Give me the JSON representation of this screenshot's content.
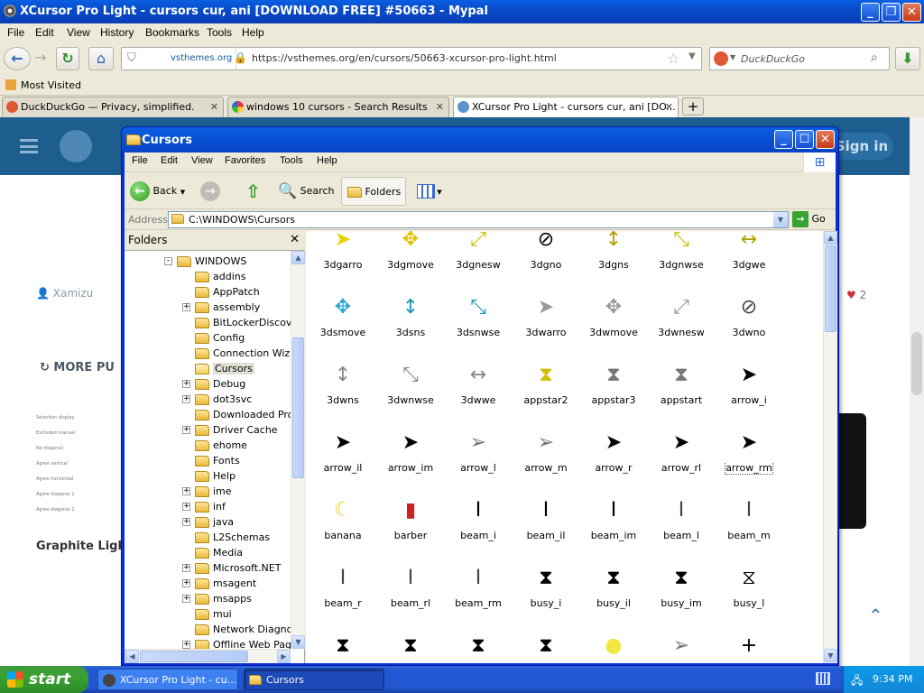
{
  "browser": {
    "title": "XCursor Pro Light - cursors cur, ani [DOWNLOAD FREE] #50663 - Mypal",
    "menu": [
      "File",
      "Edit",
      "View",
      "History",
      "Bookmarks",
      "Tools",
      "Help"
    ],
    "identity": "vsthemes.org",
    "url": "https://vsthemes.org/en/cursors/50663-xcursor-pro-light.html",
    "search_placeholder": "DuckDuckGo",
    "bookmark": "Most Visited",
    "tabs": [
      {
        "label": "DuckDuckGo — Privacy, simplified."
      },
      {
        "label": "windows 10 cursors - Search Results"
      },
      {
        "label": "XCursor Pro Light - cursors cur, ani [DO..."
      }
    ]
  },
  "webpage": {
    "signin": "Sign in",
    "author": "Xamizu",
    "more": "MORE PU",
    "likes": "2",
    "card_title": "Graphite Ligh",
    "card_lines": [
      "Selection display",
      "Excluded manual",
      "No diagonal",
      "Agree vertical",
      "Agree horizontal",
      "Agree diagonal 1",
      "Agree diagonal 2"
    ]
  },
  "explorer": {
    "title": "Cursors",
    "menu": [
      "File",
      "Edit",
      "View",
      "Favorites",
      "Tools",
      "Help"
    ],
    "toolbar": {
      "back": "Back",
      "search": "Search",
      "folders": "Folders"
    },
    "address_label": "Address",
    "address": "C:\\WINDOWS\\Cursors",
    "go": "Go",
    "folders_header": "Folders",
    "tree": [
      {
        "label": "WINDOWS",
        "level": 0,
        "exp": "-"
      },
      {
        "label": "addins",
        "level": 1,
        "exp": ""
      },
      {
        "label": "AppPatch",
        "level": 1,
        "exp": ""
      },
      {
        "label": "assembly",
        "level": 1,
        "exp": "+"
      },
      {
        "label": "BitLockerDiscover",
        "level": 1,
        "exp": ""
      },
      {
        "label": "Config",
        "level": 1,
        "exp": ""
      },
      {
        "label": "Connection Wizar",
        "level": 1,
        "exp": ""
      },
      {
        "label": "Cursors",
        "level": 1,
        "exp": "",
        "selected": true
      },
      {
        "label": "Debug",
        "level": 1,
        "exp": "+"
      },
      {
        "label": "dot3svc",
        "level": 1,
        "exp": "+"
      },
      {
        "label": "Downloaded Prog",
        "level": 1,
        "exp": ""
      },
      {
        "label": "Driver Cache",
        "level": 1,
        "exp": "+"
      },
      {
        "label": "ehome",
        "level": 1,
        "exp": ""
      },
      {
        "label": "Fonts",
        "level": 1,
        "exp": ""
      },
      {
        "label": "Help",
        "level": 1,
        "exp": ""
      },
      {
        "label": "ime",
        "level": 1,
        "exp": "+"
      },
      {
        "label": "inf",
        "level": 1,
        "exp": "+"
      },
      {
        "label": "java",
        "level": 1,
        "exp": "+"
      },
      {
        "label": "L2Schemas",
        "level": 1,
        "exp": ""
      },
      {
        "label": "Media",
        "level": 1,
        "exp": ""
      },
      {
        "label": "Microsoft.NET",
        "level": 1,
        "exp": "+"
      },
      {
        "label": "msagent",
        "level": 1,
        "exp": "+"
      },
      {
        "label": "msapps",
        "level": 1,
        "exp": "+"
      },
      {
        "label": "mui",
        "level": 1,
        "exp": ""
      },
      {
        "label": "Network Diagnost",
        "level": 1,
        "exp": ""
      },
      {
        "label": "Offline Web Page",
        "level": 1,
        "exp": "+"
      }
    ],
    "files": [
      {
        "name": "3dgarro",
        "icon": "arrow-icon",
        "glyph": "➤",
        "color": "#e6d200"
      },
      {
        "name": "3dgmove",
        "icon": "move-icon",
        "glyph": "✥",
        "color": "#e0c000"
      },
      {
        "name": "3dgnesw",
        "icon": "resize-nesw-icon",
        "glyph": "⤢",
        "color": "#c8c000"
      },
      {
        "name": "3dgno",
        "icon": "unavailable-icon",
        "glyph": "⊘",
        "color": "#000000"
      },
      {
        "name": "3dgns",
        "icon": "resize-ns-icon",
        "glyph": "↕",
        "color": "#b0a000"
      },
      {
        "name": "3dgnwse",
        "icon": "resize-nwse-icon",
        "glyph": "⤡",
        "color": "#c8c000"
      },
      {
        "name": "3dgwe",
        "icon": "resize-we-icon",
        "glyph": "↔",
        "color": "#b0a000"
      },
      {
        "name": "3dsmove",
        "icon": "move-icon",
        "glyph": "✥",
        "color": "#2aa6c8"
      },
      {
        "name": "3dsns",
        "icon": "resize-ns-icon",
        "glyph": "↕",
        "color": "#1a96b0"
      },
      {
        "name": "3dsnwse",
        "icon": "resize-nwse-icon",
        "glyph": "⤡",
        "color": "#1a96b0"
      },
      {
        "name": "3dwarro",
        "icon": "arrow-icon",
        "glyph": "➤",
        "color": "#999999"
      },
      {
        "name": "3dwmove",
        "icon": "move-icon",
        "glyph": "✥",
        "color": "#999999"
      },
      {
        "name": "3dwnesw",
        "icon": "resize-nesw-icon",
        "glyph": "⤢",
        "color": "#999999"
      },
      {
        "name": "3dwno",
        "icon": "unavailable-icon",
        "glyph": "⊘",
        "color": "#444444"
      },
      {
        "name": "3dwns",
        "icon": "resize-ns-icon",
        "glyph": "↕",
        "color": "#888888"
      },
      {
        "name": "3dwnwse",
        "icon": "resize-nwse-icon",
        "glyph": "⤡",
        "color": "#888888"
      },
      {
        "name": "3dwwe",
        "icon": "resize-we-icon",
        "glyph": "↔",
        "color": "#888888"
      },
      {
        "name": "appstar2",
        "icon": "app-starting-icon",
        "glyph": "⧗",
        "color": "#d0c000"
      },
      {
        "name": "appstar3",
        "icon": "app-starting-icon",
        "glyph": "⧗",
        "color": "#777777"
      },
      {
        "name": "appstart",
        "icon": "app-starting-icon",
        "glyph": "⧗",
        "color": "#777777"
      },
      {
        "name": "arrow_i",
        "icon": "arrow-icon",
        "glyph": "➤",
        "color": "#000000"
      },
      {
        "name": "arrow_il",
        "icon": "arrow-icon",
        "glyph": "➤",
        "color": "#000000"
      },
      {
        "name": "arrow_im",
        "icon": "arrow-icon",
        "glyph": "➤",
        "color": "#000000"
      },
      {
        "name": "arrow_l",
        "icon": "arrow-icon",
        "glyph": "➢",
        "color": "#777777"
      },
      {
        "name": "arrow_m",
        "icon": "arrow-icon",
        "glyph": "➢",
        "color": "#777777"
      },
      {
        "name": "arrow_r",
        "icon": "arrow-icon",
        "glyph": "➤",
        "color": "#000000"
      },
      {
        "name": "arrow_rl",
        "icon": "arrow-icon",
        "glyph": "➤",
        "color": "#000000"
      },
      {
        "name": "arrow_rm",
        "icon": "arrow-icon",
        "glyph": "➤",
        "color": "#000000",
        "selected": true
      },
      {
        "name": "banana",
        "icon": "banana-icon",
        "glyph": "☾",
        "color": "#e8d020"
      },
      {
        "name": "barber",
        "icon": "barber-pole-icon",
        "glyph": "▮",
        "color": "#cc2222"
      },
      {
        "name": "beam_i",
        "icon": "text-beam-icon",
        "glyph": "I",
        "color": "#000000"
      },
      {
        "name": "beam_il",
        "icon": "text-beam-icon",
        "glyph": "I",
        "color": "#000000"
      },
      {
        "name": "beam_im",
        "icon": "text-beam-icon",
        "glyph": "I",
        "color": "#000000"
      },
      {
        "name": "beam_l",
        "icon": "text-beam-icon",
        "glyph": "I",
        "color": "#444444"
      },
      {
        "name": "beam_m",
        "icon": "text-beam-icon",
        "glyph": "I",
        "color": "#444444"
      },
      {
        "name": "beam_r",
        "icon": "text-beam-icon",
        "glyph": "I",
        "color": "#444444"
      },
      {
        "name": "beam_rl",
        "icon": "text-beam-icon",
        "glyph": "I",
        "color": "#444444"
      },
      {
        "name": "beam_rm",
        "icon": "text-beam-icon",
        "glyph": "I",
        "color": "#444444"
      },
      {
        "name": "busy_i",
        "icon": "hourglass-icon",
        "glyph": "⧗",
        "color": "#000000"
      },
      {
        "name": "busy_il",
        "icon": "hourglass-icon",
        "glyph": "⧗",
        "color": "#000000"
      },
      {
        "name": "busy_im",
        "icon": "hourglass-icon",
        "glyph": "⧗",
        "color": "#000000"
      },
      {
        "name": "busy_l",
        "icon": "hourglass-icon",
        "glyph": "⧖",
        "color": "#000000"
      },
      {
        "name": "",
        "icon": "hourglass-icon",
        "glyph": "⧗",
        "color": "#000000"
      },
      {
        "name": "",
        "icon": "hourglass-icon",
        "glyph": "⧗",
        "color": "#000000"
      },
      {
        "name": "",
        "icon": "hourglass-icon",
        "glyph": "⧗",
        "color": "#000000"
      },
      {
        "name": "",
        "icon": "hourglass-icon",
        "glyph": "⧗",
        "color": "#000000"
      },
      {
        "name": "",
        "icon": "circle-icon",
        "glyph": "●",
        "color": "#f2e640"
      },
      {
        "name": "",
        "icon": "arrow-icon",
        "glyph": "➢",
        "color": "#777777"
      },
      {
        "name": "",
        "icon": "crosshair-icon",
        "glyph": "+",
        "color": "#000000"
      }
    ]
  },
  "taskbar": {
    "start": "start",
    "tasks": [
      {
        "label": "XCursor Pro Light - cu..."
      },
      {
        "label": "Cursors"
      }
    ],
    "clock": "9:34 PM"
  }
}
